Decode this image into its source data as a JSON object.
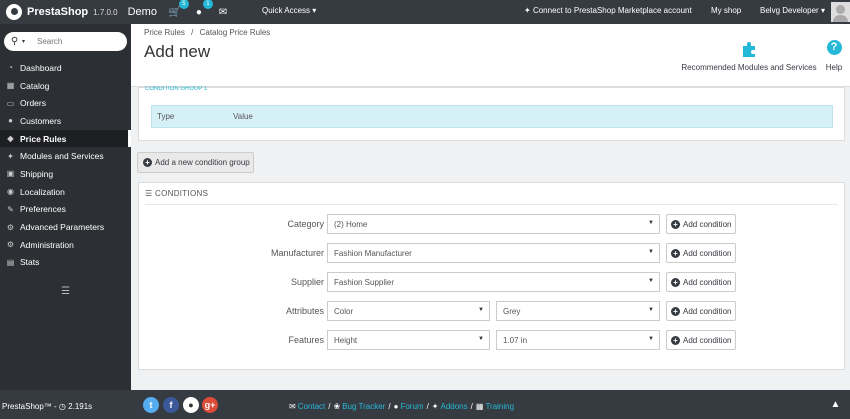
{
  "topbar": {
    "logo": "PrestaShop",
    "version": "1.7.0.0",
    "shop": "Demo",
    "cart_badge": "5",
    "customers_badge": "1",
    "quick_access": "Quick Access",
    "marketplace": "Connect to PrestaShop Marketplace account",
    "my_shop": "My shop",
    "employee": "Belvg Developer"
  },
  "sidebar": {
    "search_placeholder": "Search",
    "items": [
      {
        "label": "Dashboard",
        "icon": "dashboard-icon"
      },
      {
        "label": "Catalog",
        "icon": "catalog-icon"
      },
      {
        "label": "Orders",
        "icon": "orders-icon"
      },
      {
        "label": "Customers",
        "icon": "customers-icon"
      },
      {
        "label": "Price Rules",
        "icon": "price-rules-icon"
      },
      {
        "label": "Modules and Services",
        "icon": "modules-icon"
      },
      {
        "label": "Shipping",
        "icon": "shipping-icon"
      },
      {
        "label": "Localization",
        "icon": "localization-icon"
      },
      {
        "label": "Preferences",
        "icon": "preferences-icon"
      },
      {
        "label": "Advanced Parameters",
        "icon": "advanced-parameters-icon"
      },
      {
        "label": "Administration",
        "icon": "administration-icon"
      },
      {
        "label": "Stats",
        "icon": "stats-icon"
      }
    ],
    "active_index": 4
  },
  "header": {
    "breadcrumb_1": "Price Rules",
    "breadcrumb_sep": "/",
    "breadcrumb_2": "Catalog Price Rules",
    "title": "Add new",
    "recommended": "Recommended Modules and Services",
    "help": "Help"
  },
  "condition_group": {
    "title": "CONDITION GROUP 1",
    "col_type": "Type",
    "col_value": "Value",
    "add_group": "Add a new condition group"
  },
  "conditions": {
    "heading": "CONDITIONS",
    "add_condition": "Add condition",
    "category_label": "Category",
    "category_value": "(2) Home",
    "manufacturer_label": "Manufacturer",
    "manufacturer_value": "Fashion Manufacturer",
    "supplier_label": "Supplier",
    "supplier_value": "Fashion Supplier",
    "attributes_label": "Attributes",
    "attribute_group": "Color",
    "attribute_value": "Grey",
    "features_label": "Features",
    "feature_group": "Height",
    "feature_value": "1.07 in"
  },
  "footer": {
    "brand": "PrestaShop™ - ",
    "timer": "2.191s",
    "contact": "Contact",
    "bug_tracker": "Bug Tracker",
    "forum": "Forum",
    "addons": "Addons",
    "training": "Training",
    "social": [
      {
        "name": "twitter-icon",
        "glyph": "t",
        "color": "#55acee"
      },
      {
        "name": "facebook-icon",
        "glyph": "f",
        "color": "#3b5998"
      },
      {
        "name": "github-icon",
        "glyph": "g",
        "color": "#ffffff"
      },
      {
        "name": "google-plus-icon",
        "glyph": "g+",
        "color": "#dd4b39"
      }
    ]
  },
  "colors": {
    "accent": "#25b9d7",
    "topbar": "#363a41",
    "sidebar": "#2c2f33"
  }
}
